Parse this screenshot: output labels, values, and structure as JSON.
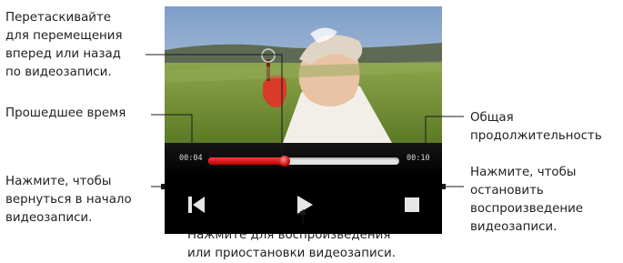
{
  "player": {
    "elapsed_time": "00:04",
    "total_time": "00:10",
    "progress_percent": 40,
    "controls": {
      "previous_icon": "skip-to-start-icon",
      "play_icon": "play-icon",
      "stop_icon": "stop-icon"
    }
  },
  "annotations": {
    "drag_seek": "Перетаскивайте\nдля перемещения\nвперед или назад\nпо видеозаписи.",
    "elapsed": "Прошедшее время",
    "total": "Общая\nпродолжительность",
    "restart": "Нажмите, чтобы\nвернуться в начало\nвидеозаписи.",
    "stop": "Нажмите, чтобы\nостановить\nвоспроизведение\nвидеозаписи.",
    "play_pause": "Нажмите для воспроизведения\nили приостановки видеозаписи."
  },
  "colors": {
    "progress_fill": "#d40000",
    "track": "#e4e4e4",
    "controls_background": "#000000",
    "callout_line": "#1a1a1a"
  }
}
